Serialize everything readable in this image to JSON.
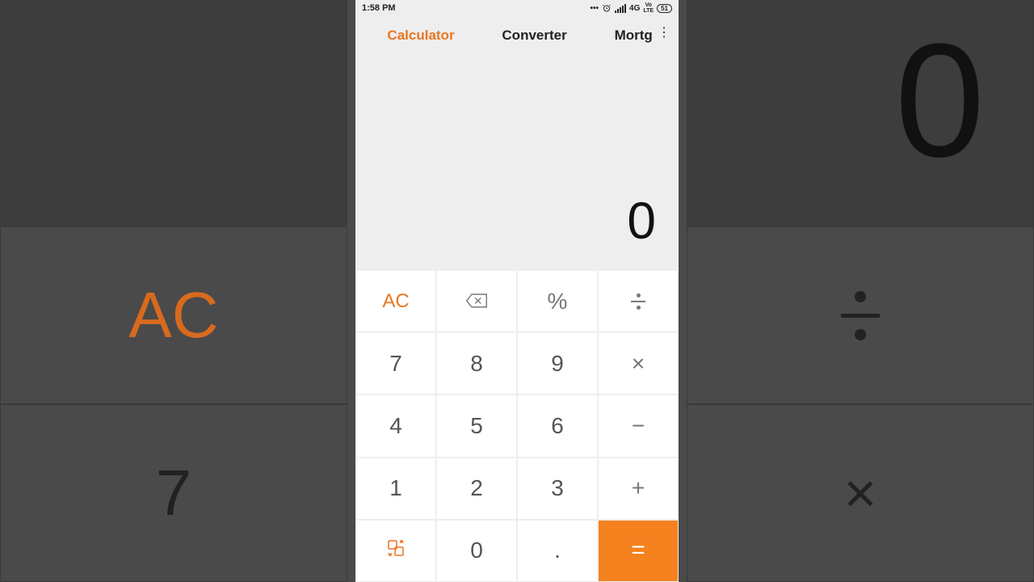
{
  "statusbar": {
    "time": "1:58 PM",
    "network": "4G",
    "volte": "VoLTE",
    "battery": "51"
  },
  "tabs": {
    "calculator": "Calculator",
    "converter": "Converter",
    "mortgage": "Mortgage"
  },
  "display": {
    "value": "0"
  },
  "keys": {
    "ac": "AC",
    "percent": "%",
    "d7": "7",
    "d8": "8",
    "d9": "9",
    "d4": "4",
    "d5": "5",
    "d6": "6",
    "d1": "1",
    "d2": "2",
    "d3": "3",
    "d0": "0",
    "dot": ".",
    "multiply": "×",
    "minus": "−",
    "plus": "+",
    "equals": "="
  },
  "bg": {
    "zero": "0",
    "ac": "AC",
    "seven": "7",
    "multiply": "×"
  },
  "colors": {
    "accent": "#e87722",
    "equalsBg": "#f5821f"
  }
}
